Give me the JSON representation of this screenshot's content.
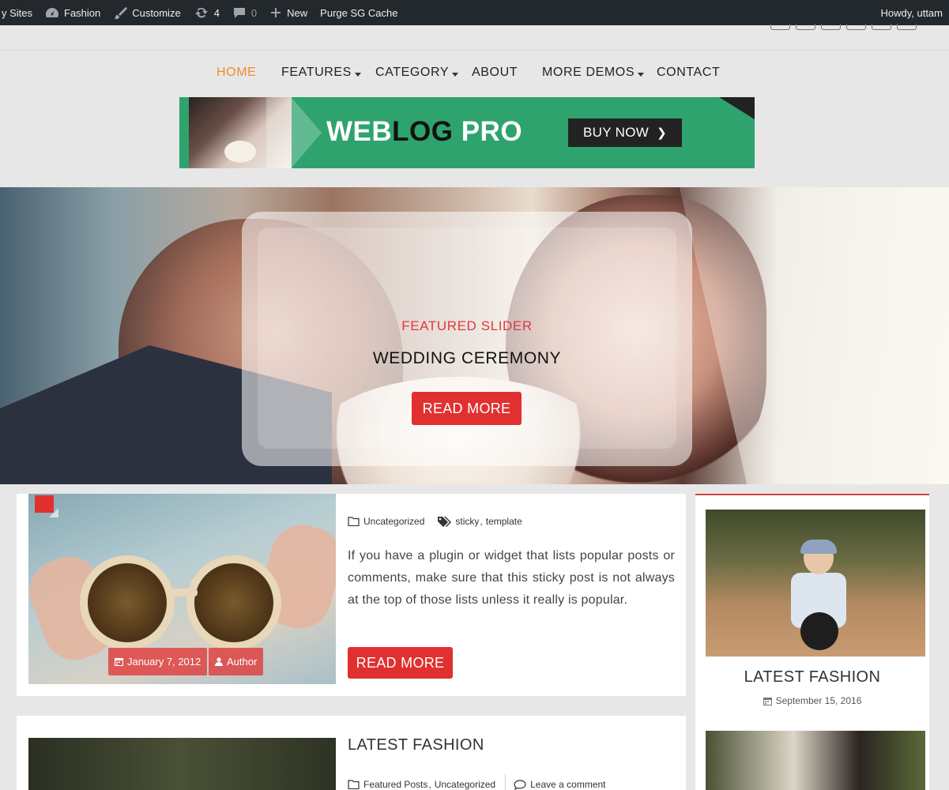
{
  "admin_bar": {
    "sites": "y Sites",
    "site_name": "Fashion",
    "customize": "Customize",
    "updates_count": "4",
    "comments_count": "0",
    "new": "New",
    "purge": "Purge SG Cache",
    "howdy": "Howdy, uttam"
  },
  "nav": {
    "items": [
      "HOME",
      "FEATURES",
      "CATEGORY",
      "ABOUT",
      "MORE DEMOS",
      "CONTACT"
    ],
    "active": "HOME"
  },
  "banner": {
    "title_part1": "WEB",
    "title_part2": "LOG",
    "title_part3": " PRO",
    "button": "BUY NOW",
    "accent_color": "#2ea36e"
  },
  "slider": {
    "category": "FEATURED SLIDER",
    "title": "WEDDING CEREMONY",
    "button": "READ MORE"
  },
  "post1": {
    "category": "Uncategorized",
    "tags": [
      "sticky",
      "template"
    ],
    "tag_sep": ",",
    "excerpt": "If you have a plugin or widget that lists popular posts or comments, make sure that this sticky post is not always at the top of those lists unless it really is popular.",
    "date": "January 7, 2012",
    "author": "Author",
    "button": "READ MORE"
  },
  "post2": {
    "title": "LATEST FASHION",
    "categories": [
      "Featured Posts",
      "Uncategorized"
    ],
    "cat_sep": ",",
    "comment": "Leave a comment"
  },
  "sidebar": {
    "title": "LATEST FASHION",
    "date": "September 15, 2016"
  },
  "colors": {
    "accent_red": "#e03030",
    "nav_active": "#f08c2b",
    "admin_bar": "#23282d"
  }
}
